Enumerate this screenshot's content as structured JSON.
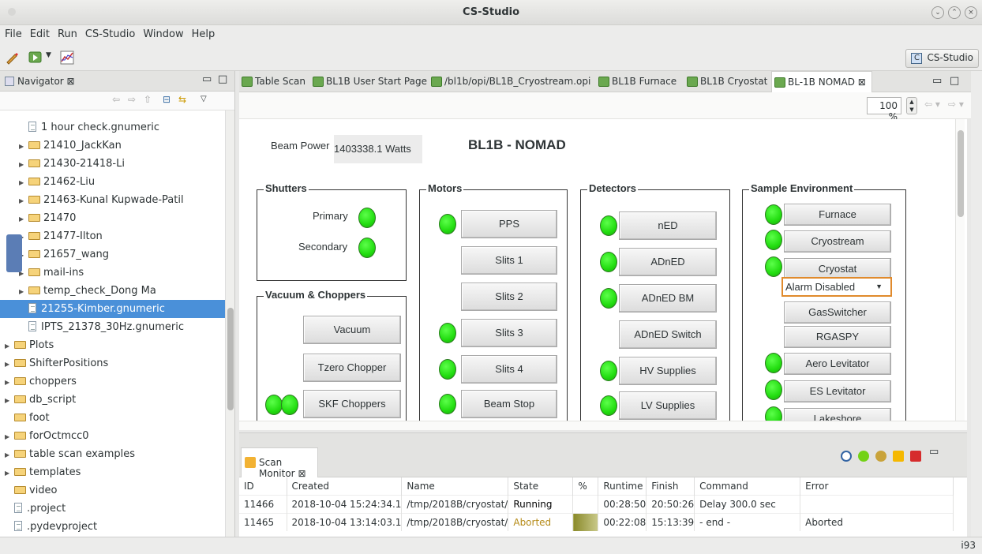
{
  "window": {
    "title": "CS-Studio"
  },
  "menu": [
    "File",
    "Edit",
    "Run",
    "CS-Studio",
    "Window",
    "Help"
  ],
  "perspective": {
    "label": "CS-Studio"
  },
  "navigator": {
    "title": "Navigator",
    "items": [
      {
        "label": "1 hour check.gnumeric",
        "kind": "file",
        "indent": 2,
        "selected": false
      },
      {
        "label": "21410_JackKan",
        "kind": "folder",
        "indent": 2,
        "selected": false
      },
      {
        "label": "21430-21418-Li",
        "kind": "folder",
        "indent": 2,
        "selected": false
      },
      {
        "label": "21462-Liu",
        "kind": "folder",
        "indent": 2,
        "selected": false
      },
      {
        "label": "21463-Kunal Kupwade-Patil",
        "kind": "folder",
        "indent": 2,
        "selected": false
      },
      {
        "label": "21470",
        "kind": "folder",
        "indent": 2,
        "selected": false
      },
      {
        "label": "21477-Ilton",
        "kind": "folder",
        "indent": 2,
        "selected": false
      },
      {
        "label": "21657_wang",
        "kind": "folder",
        "indent": 2,
        "selected": false
      },
      {
        "label": "mail-ins",
        "kind": "folder",
        "indent": 2,
        "selected": false
      },
      {
        "label": "temp_check_Dong Ma",
        "kind": "folder",
        "indent": 2,
        "selected": false
      },
      {
        "label": "21255-Kimber.gnumeric",
        "kind": "file",
        "indent": 2,
        "selected": true
      },
      {
        "label": "IPTS_21378_30Hz.gnumeric",
        "kind": "file",
        "indent": 2,
        "selected": false
      },
      {
        "label": "Plots",
        "kind": "folder",
        "indent": 1,
        "selected": false
      },
      {
        "label": "ShifterPositions",
        "kind": "folder",
        "indent": 1,
        "selected": false
      },
      {
        "label": "choppers",
        "kind": "folder",
        "indent": 1,
        "selected": false
      },
      {
        "label": "db_script",
        "kind": "folder",
        "indent": 1,
        "selected": false
      },
      {
        "label": "foot",
        "kind": "folder-open",
        "indent": 1,
        "selected": false
      },
      {
        "label": "forOctmcc0",
        "kind": "folder",
        "indent": 1,
        "selected": false
      },
      {
        "label": "table scan examples",
        "kind": "folder",
        "indent": 1,
        "selected": false
      },
      {
        "label": "templates",
        "kind": "folder",
        "indent": 1,
        "selected": false
      },
      {
        "label": "video",
        "kind": "folder-open",
        "indent": 1,
        "selected": false
      },
      {
        "label": ".project",
        "kind": "file",
        "indent": 1,
        "selected": false
      },
      {
        "label": ".pydevproject",
        "kind": "file",
        "indent": 1,
        "selected": false
      }
    ]
  },
  "editor_tabs": [
    {
      "label": "Table Scan",
      "active": false
    },
    {
      "label": "BL1B User Start Page",
      "active": false
    },
    {
      "label": "/bl1b/opi/BL1B_Cryostream.opi",
      "active": false
    },
    {
      "label": "BL1B Furnace",
      "active": false
    },
    {
      "label": "BL1B Cryostat",
      "active": false
    },
    {
      "label": "BL-1B NOMAD",
      "active": true
    }
  ],
  "zoom": "100 %",
  "opi": {
    "title": "BL1B - NOMAD",
    "beam_power_label": "Beam Power",
    "beam_power_value": "1403338.1 Watts",
    "led_color": "#22dd10",
    "shutters": {
      "title": "Shutters",
      "primary": "Primary",
      "secondary": "Secondary"
    },
    "vacuum": {
      "title": "Vacuum & Choppers",
      "buttons": [
        "Vacuum",
        "Tzero Chopper",
        "SKF Choppers"
      ]
    },
    "motors": {
      "title": "Motors",
      "buttons": [
        "PPS",
        "Slits 1",
        "Slits 2",
        "Slits 3",
        "Slits 4",
        "Beam Stop"
      ]
    },
    "detectors": {
      "title": "Detectors",
      "buttons": [
        "nED",
        "ADnED",
        "ADnED BM",
        "ADnED Switch",
        "HV Supplies",
        "LV Supplies"
      ]
    },
    "sample_env": {
      "title": "Sample Environment",
      "buttons": [
        "Furnace",
        "Cryostream",
        "Cryostat",
        "GasSwitcher",
        "RGASPY",
        "Aero Levitator",
        "ES Levitator",
        "Lakeshore"
      ],
      "alarm_combo": "Alarm Disabled"
    }
  },
  "scan_monitor": {
    "title": "Scan Monitor",
    "columns": [
      "ID",
      "Created",
      "Name",
      "State",
      "%",
      "Runtime",
      "Finish",
      "Command",
      "Error"
    ],
    "rows": [
      {
        "id": "11466",
        "created": "2018-10-04 15:24:34.1",
        "name": "/tmp/2018B/cryostat/",
        "state": "Running",
        "pct": "",
        "runtime": "00:28:50",
        "finish": "20:50:26",
        "command": "Delay 300.0 sec",
        "error": ""
      },
      {
        "id": "11465",
        "created": "2018-10-04 13:14:03.1",
        "name": "/tmp/2018B/cryostat/",
        "state": "Aborted",
        "pct": "",
        "runtime": "00:22:08",
        "finish": "15:13:39",
        "command": "- end -",
        "error": "Aborted"
      }
    ]
  },
  "status": {
    "memory": "i93"
  }
}
